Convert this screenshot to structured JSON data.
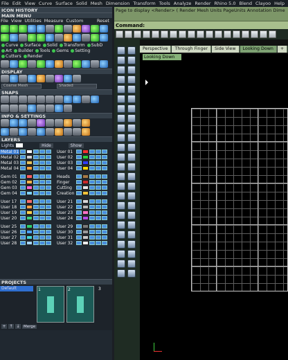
{
  "menubar": [
    "File",
    "Edit",
    "View",
    "Curve",
    "Surface",
    "Solid",
    "Mesh",
    "Dimension",
    "Transform",
    "Tools",
    "Analyze",
    "Render",
    "Rhino 5.0",
    "Blend",
    "Clayoo",
    "Help"
  ],
  "panels": {
    "icon_history": "ICON HISTORY",
    "main_menu": "MAIN MENU",
    "display": "DISPLAY",
    "snaps": "SNAPS",
    "info_settings": "INFO & SETTINGS",
    "layers": "LAYERS",
    "projects": "PROJECTS"
  },
  "main_menu_items": [
    "File",
    "View",
    "Utilities",
    "Measure",
    "Custom"
  ],
  "reset_label": "Reset",
  "mode_tabs": [
    "Curve",
    "Surface",
    "Solid",
    "Transform",
    "SubD",
    "Art",
    "Builder",
    "Tools",
    "Gems",
    "Setting",
    "Cutters",
    "Render"
  ],
  "display": {
    "mesh_label": "Coarse Mesh",
    "shade_label": "Shaded"
  },
  "layers_header": {
    "lights": "Lights",
    "hide": "Hide",
    "show": "Show"
  },
  "layers_left": [
    {
      "name": "Metal 01",
      "color": "#ffffff",
      "selected": true
    },
    {
      "name": "Metal 02",
      "color": "#d0d0d0",
      "selected": false
    },
    {
      "name": "Metal 03",
      "color": "#e6c35a",
      "selected": false
    },
    {
      "name": "Metal 04",
      "color": "#f2a33a",
      "selected": false
    },
    {
      "name": "Gem 01",
      "color": "#ff5e5e",
      "selected": false
    },
    {
      "name": "Gem 02",
      "color": "#ffb347",
      "selected": false
    },
    {
      "name": "Gem 03",
      "color": "#ff66cc",
      "selected": false
    },
    {
      "name": "Gem 04",
      "color": "#7fd3ff",
      "selected": false
    },
    {
      "name": "User 17",
      "color": "#ff6e6e",
      "selected": false
    },
    {
      "name": "User 18",
      "color": "#ff9e44",
      "selected": false
    },
    {
      "name": "User 19",
      "color": "#ffd24a",
      "selected": false
    },
    {
      "name": "User 20",
      "color": "#3fd37a",
      "selected": false
    },
    {
      "name": "User 25",
      "color": "#2dcf6a",
      "selected": false
    },
    {
      "name": "User 26",
      "color": "#4aa3ff",
      "selected": false
    },
    {
      "name": "User 27",
      "color": "#42d6d6",
      "selected": false
    },
    {
      "name": "User 28",
      "color": "#a5d6ff",
      "selected": false
    }
  ],
  "layers_right": [
    {
      "name": "User 01",
      "color": "#ff2f2f"
    },
    {
      "name": "User 02",
      "color": "#2ad23a"
    },
    {
      "name": "User 03",
      "color": "#2f3dff"
    },
    {
      "name": "User 04",
      "color": "#ffd800"
    },
    {
      "name": "Heads",
      "color": "#a67a45"
    },
    {
      "name": "Finger",
      "color": "#cc2a2a"
    },
    {
      "name": "Cutting",
      "color": "#e6e6e6"
    },
    {
      "name": "Creation",
      "color": "#f0c23a"
    },
    {
      "name": "User 21",
      "color": "#d7d7d7"
    },
    {
      "name": "User 22",
      "color": "#b8b8b8"
    },
    {
      "name": "User 23",
      "color": "#ff72c8"
    },
    {
      "name": "User 24",
      "color": "#b54ae8"
    },
    {
      "name": "User 29",
      "color": "#7a7a7a"
    },
    {
      "name": "User 30",
      "color": "#9b9b9b"
    },
    {
      "name": "User 31",
      "color": "#c8c8c8"
    },
    {
      "name": "User 32",
      "color": "#ebebeb"
    }
  ],
  "projects": {
    "default": "Default",
    "thumb_numbers": [
      "1",
      "2",
      "3"
    ],
    "merge": "Merge"
  },
  "command_history": "Page to display <Render> ( Render  Mesh  Units  PageUnits  Annotation  Dime",
  "command_prompt": "Command:",
  "viewport_tabs": [
    "Perspective",
    "Through Finger",
    "Side View",
    "Looking Down"
  ],
  "active_viewport": "Looking Down"
}
